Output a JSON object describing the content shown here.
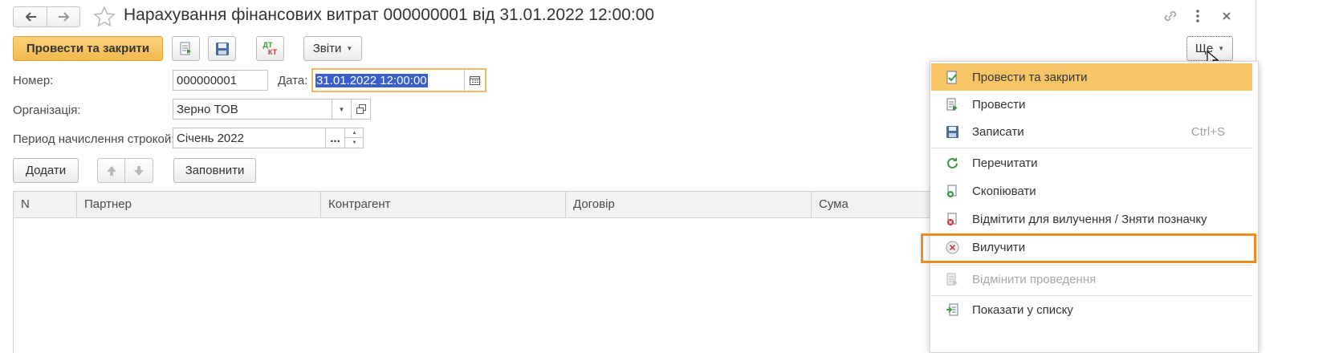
{
  "window": {
    "title": "Нарахування фінансових витрат 000000001 від 31.01.2022 12:00:00"
  },
  "toolbar": {
    "post_close_label": "Провести та закрити",
    "dtkt_top": "ДТ",
    "dtkt_bottom": "КТ",
    "reports_label": "Звіти",
    "more_label": "Ще"
  },
  "form": {
    "number_label": "Номер:",
    "number_value": "000000001",
    "date_label": "Дата:",
    "date_value": "31.01.2022 12:00:00",
    "org_label": "Організація:",
    "org_value": "Зерно ТОВ",
    "period_label": "Период начислення строкой:",
    "period_value": "Січень 2022",
    "period_choose": "..."
  },
  "table_toolbar": {
    "add_label": "Додати",
    "fill_label": "Заповнити"
  },
  "table": {
    "columns": [
      "N",
      "Партнер",
      "Контрагент",
      "Договір",
      "Сума"
    ],
    "rows": []
  },
  "menu": {
    "items": [
      {
        "label": "Провести та закрити",
        "icon": "post-close-icon",
        "highlighted": true
      },
      {
        "label": "Провести",
        "icon": "post-icon"
      },
      {
        "label": "Записати",
        "icon": "save-icon",
        "shortcut": "Ctrl+S"
      },
      {
        "label": "Перечитати",
        "icon": "refresh-icon"
      },
      {
        "label": "Скопіювати",
        "icon": "copy-icon"
      },
      {
        "label": "Відмітити для вилучення / Зняти позначку",
        "icon": "mark-delete-icon"
      },
      {
        "label": "Вилучити",
        "icon": "delete-icon",
        "outlined": true
      },
      {
        "label": "Відмінити проведення",
        "icon": "unpost-icon",
        "disabled": true
      },
      {
        "label": "Показати у списку",
        "icon": "show-in-list-icon"
      }
    ]
  },
  "colors": {
    "accent": "#f7c566",
    "highlight_outline": "#f08a24",
    "selection": "#3a5fcd",
    "green_icon": "#3a9a3a",
    "red_icon": "#d03030"
  }
}
